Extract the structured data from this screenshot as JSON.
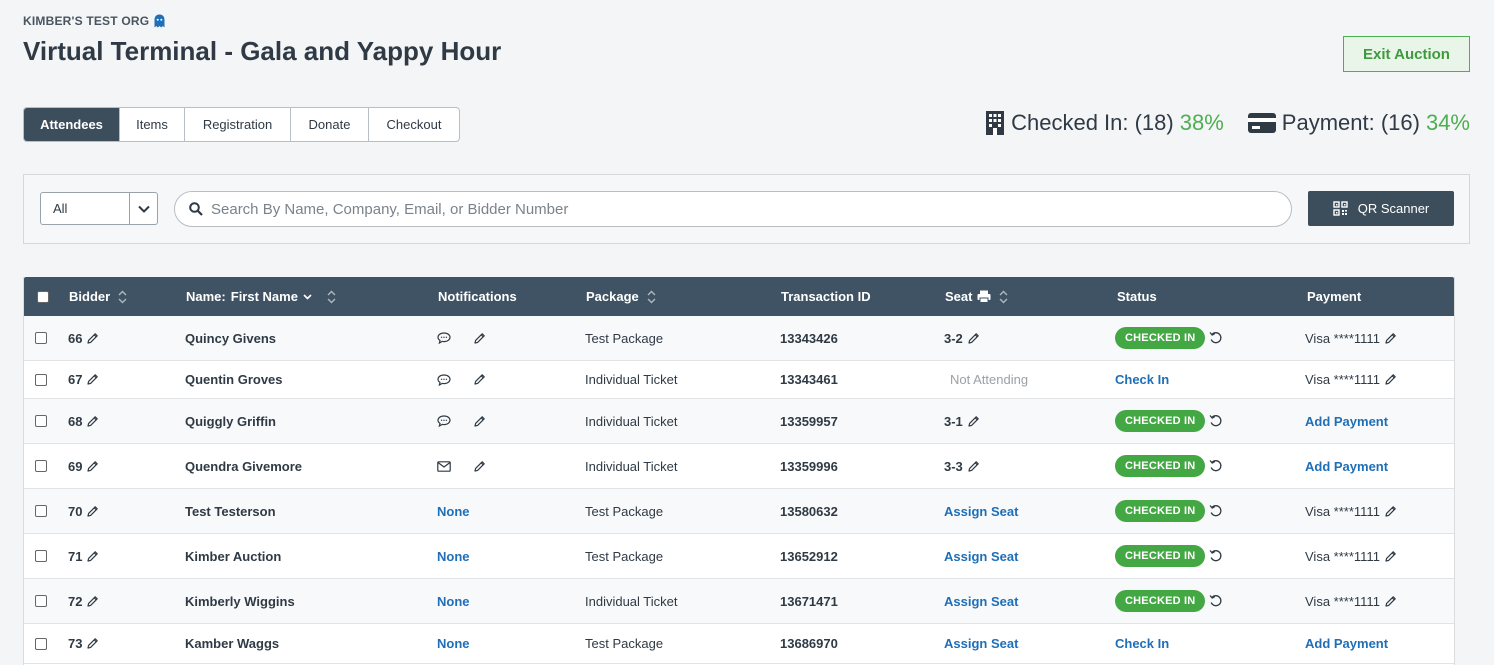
{
  "org_name": "KIMBER'S TEST ORG",
  "page_title": "Virtual Terminal - Gala and Yappy Hour",
  "exit_label": "Exit Auction",
  "tabs": [
    {
      "label": "Attendees",
      "active": true
    },
    {
      "label": "Items",
      "active": false
    },
    {
      "label": "Registration",
      "active": false
    },
    {
      "label": "Donate",
      "active": false
    },
    {
      "label": "Checkout",
      "active": false
    }
  ],
  "stats": {
    "checked_in_label": "Checked In: (18)",
    "checked_in_pct": "38%",
    "payment_label": "Payment: (16)",
    "payment_pct": "34%"
  },
  "filter": {
    "select_value": "All",
    "search_placeholder": "Search By Name, Company, Email, or Bidder Number",
    "qr_label": "QR Scanner"
  },
  "columns": {
    "bidder": "Bidder",
    "name": "Name:",
    "name_sort": "First Name",
    "notifications": "Notifications",
    "package": "Package",
    "transaction": "Transaction ID",
    "seat": "Seat",
    "status": "Status",
    "payment": "Payment"
  },
  "colors": {
    "header_bg": "#3f5364",
    "accent_green": "#4caf50",
    "link_blue": "#1f6fb7"
  },
  "rows": [
    {
      "bidder": "66",
      "name": "Quincy Givens",
      "notif_type": "chat",
      "notif_text": "",
      "package": "Test Package",
      "txn": "13343426",
      "seat": "3-2",
      "seat_type": "value",
      "status": "CHECKED IN",
      "status_type": "badge",
      "payment": "Visa ****1111",
      "payment_type": "card"
    },
    {
      "bidder": "67",
      "name": "Quentin Groves",
      "notif_type": "chat",
      "notif_text": "",
      "package": "Individual Ticket",
      "txn": "13343461",
      "seat": "Not Attending",
      "seat_type": "muted",
      "status": "Check In",
      "status_type": "link",
      "payment": "Visa ****1111",
      "payment_type": "card"
    },
    {
      "bidder": "68",
      "name": "Quiggly Griffin",
      "notif_type": "chat",
      "notif_text": "",
      "package": "Individual Ticket",
      "txn": "13359957",
      "seat": "3-1",
      "seat_type": "value",
      "status": "CHECKED IN",
      "status_type": "badge",
      "payment": "Add Payment",
      "payment_type": "link"
    },
    {
      "bidder": "69",
      "name": "Quendra Givemore",
      "notif_type": "mail",
      "notif_text": "",
      "package": "Individual Ticket",
      "txn": "13359996",
      "seat": "3-3",
      "seat_type": "value",
      "status": "CHECKED IN",
      "status_type": "badge",
      "payment": "Add Payment",
      "payment_type": "link"
    },
    {
      "bidder": "70",
      "name": "Test Testerson",
      "notif_type": "none",
      "notif_text": "None",
      "package": "Test Package",
      "txn": "13580632",
      "seat": "Assign Seat",
      "seat_type": "link",
      "status": "CHECKED IN",
      "status_type": "badge",
      "payment": "Visa ****1111",
      "payment_type": "card"
    },
    {
      "bidder": "71",
      "name": "Kimber Auction",
      "notif_type": "none",
      "notif_text": "None",
      "package": "Test Package",
      "txn": "13652912",
      "seat": "Assign Seat",
      "seat_type": "link",
      "status": "CHECKED IN",
      "status_type": "badge",
      "payment": "Visa ****1111",
      "payment_type": "card"
    },
    {
      "bidder": "72",
      "name": "Kimberly Wiggins",
      "notif_type": "none",
      "notif_text": "None",
      "package": "Individual Ticket",
      "txn": "13671471",
      "seat": "Assign Seat",
      "seat_type": "link",
      "status": "CHECKED IN",
      "status_type": "badge",
      "payment": "Visa ****1111",
      "payment_type": "card"
    },
    {
      "bidder": "73",
      "name": "Kamber Waggs",
      "notif_type": "none",
      "notif_text": "None",
      "package": "Test Package",
      "txn": "13686970",
      "seat": "Assign Seat",
      "seat_type": "link",
      "status": "Check In",
      "status_type": "link",
      "payment": "Add Payment",
      "payment_type": "link"
    }
  ]
}
